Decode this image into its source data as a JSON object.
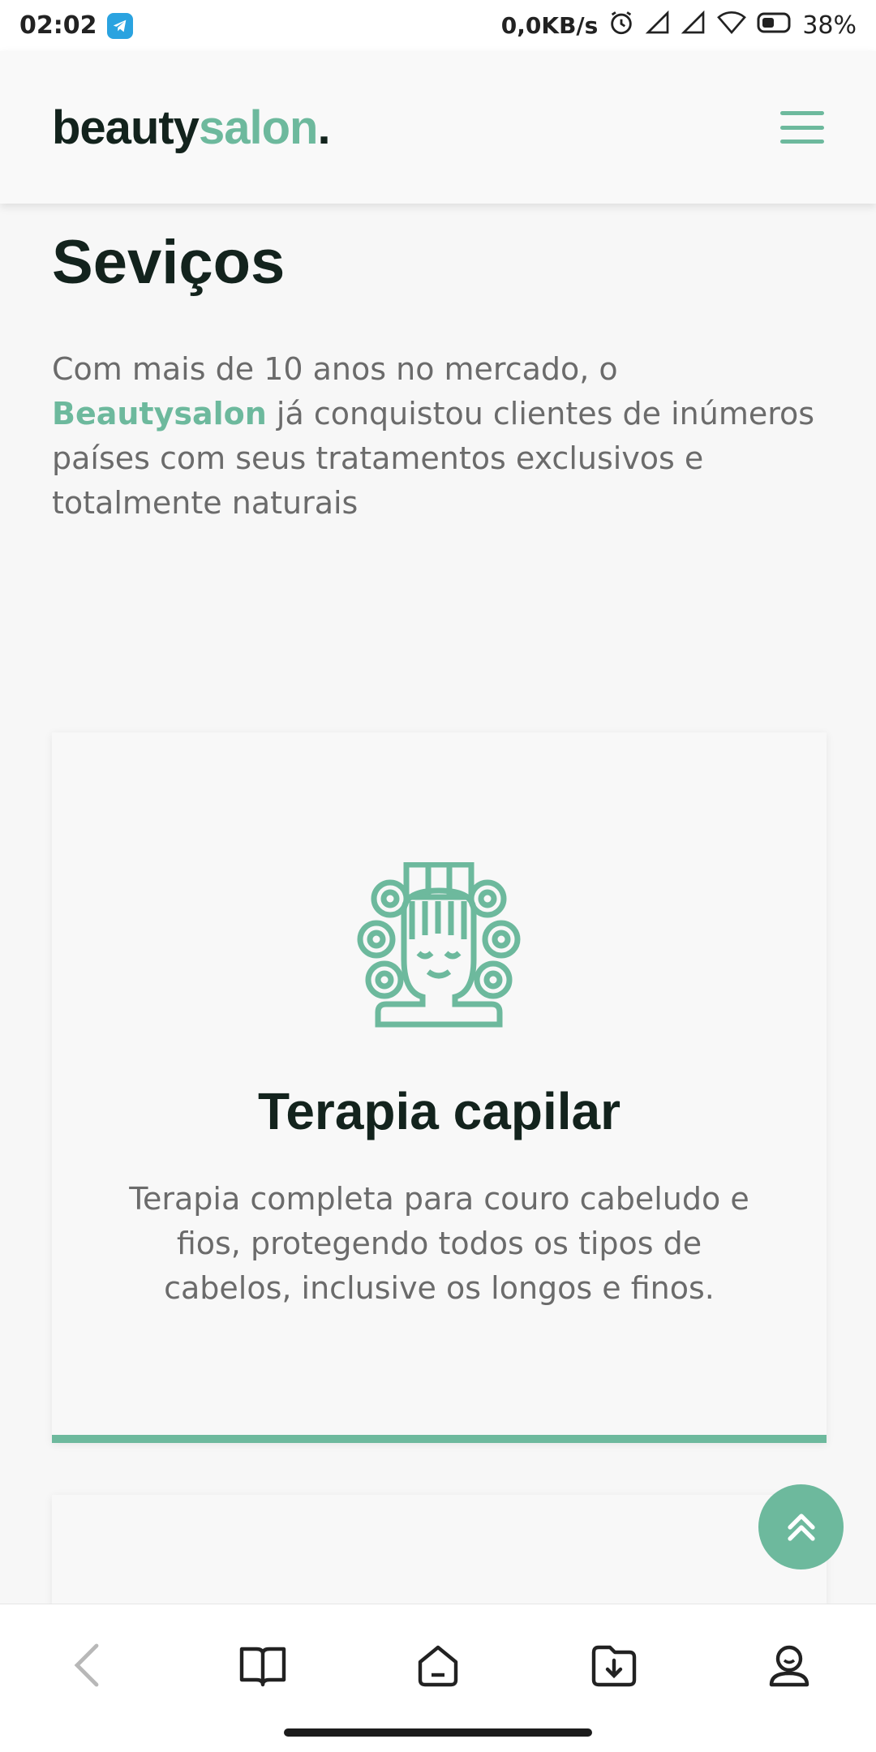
{
  "status_bar": {
    "time": "02:02",
    "net_speed": "0,0KB/s",
    "battery": "38%"
  },
  "header": {
    "logo_main": "beauty",
    "logo_accent": "salon",
    "logo_dot": "."
  },
  "section": {
    "title": "Seviços",
    "desc_before": "Com mais de 10 anos no mercado, o ",
    "desc_brand": "Beautysalon",
    "desc_after": " já conquistou clientes de inúmeros países com seus tratamentos exclusivos e totalmente naturais"
  },
  "card": {
    "icon": "hair-rollers-icon",
    "title": "Terapia capilar",
    "description": "Terapia completa para couro cabeludo e fios, protegendo todos os tipos de cabelos, inclusive os longos e finos."
  },
  "scroll_top": {
    "icon": "double-chevron-up-icon"
  },
  "bottom_nav": {
    "icons": [
      "back-icon",
      "book-icon",
      "home-icon",
      "download-icon",
      "profile-icon"
    ]
  },
  "colors": {
    "accent": "#6db99d",
    "heading": "#13231d",
    "body_text": "#6b6b6b",
    "background": "#f7f7f7"
  }
}
